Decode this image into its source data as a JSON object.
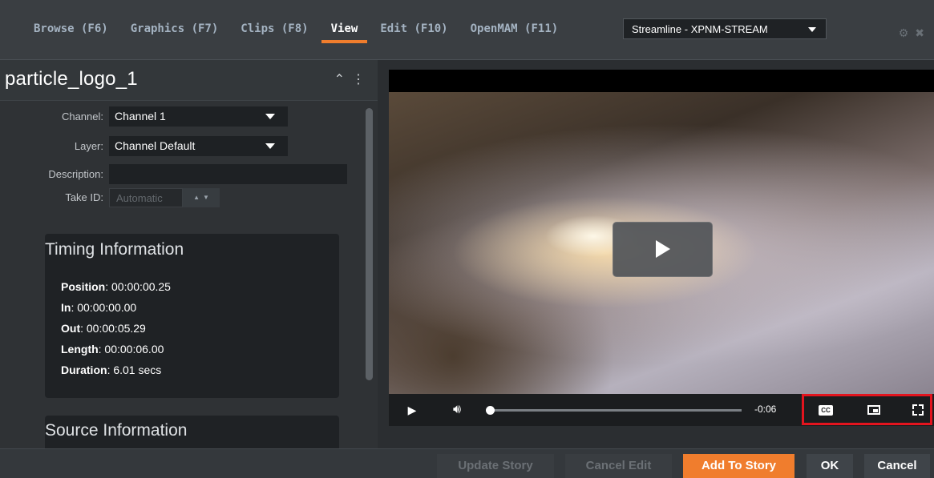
{
  "tabs": [
    "Browse (F6)",
    "Graphics (F7)",
    "Clips (F8)",
    "View",
    "Edit (F10)",
    "OpenMAM (F11)"
  ],
  "active_tab": "View",
  "environment_select": "Streamline - XPNM-STREAM",
  "panel": {
    "title": "particle_logo_1",
    "channel_label": "Channel:",
    "channel_value": "Channel 1",
    "layer_label": "Layer:",
    "layer_value": "Channel Default",
    "description_label": "Description:",
    "description_value": "",
    "takeid_label": "Take ID:",
    "takeid_placeholder": "Automatic"
  },
  "timing": {
    "title": "Timing Information",
    "position_label": "Position",
    "position_value": ": 00:00:00.25",
    "in_label": "In",
    "in_value": ": 00:00:00.00",
    "out_label": "Out",
    "out_value": ": 00:00:05.29",
    "length_label": "Length",
    "length_value": ": 00:00:06.00",
    "duration_label": "Duration",
    "duration_value": ": 6.01 secs"
  },
  "source": {
    "title": "Source Information"
  },
  "player": {
    "time_remaining": "-0:06",
    "progress_fraction": 0.0,
    "cc_label": "CC"
  },
  "buttons": {
    "update_story": "Update Story",
    "cancel_edit": "Cancel Edit",
    "add_to_story": "Add To Story",
    "ok": "OK",
    "cancel": "Cancel"
  },
  "colors": {
    "accent": "#f07d2d",
    "highlight": "#e3141e"
  }
}
